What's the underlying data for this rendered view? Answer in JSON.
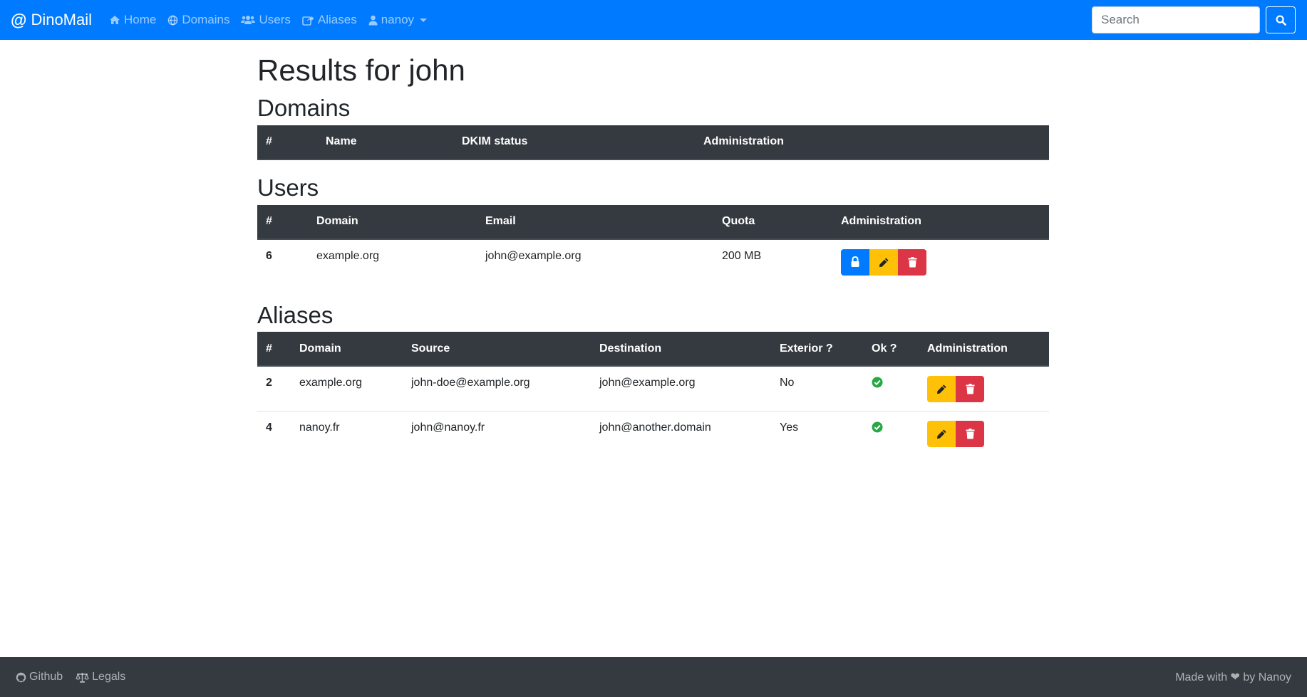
{
  "navbar": {
    "brand": "DinoMail",
    "items": [
      {
        "label": "Home",
        "icon": "home-icon"
      },
      {
        "label": "Domains",
        "icon": "globe-icon"
      },
      {
        "label": "Users",
        "icon": "users-icon"
      },
      {
        "label": "Aliases",
        "icon": "share-icon"
      }
    ],
    "user_menu": {
      "label": "nanoy",
      "icon": "user-icon"
    },
    "search": {
      "placeholder": "Search",
      "value": ""
    }
  },
  "page": {
    "title": "Results for john"
  },
  "domains_section": {
    "title": "Domains",
    "columns": [
      "#",
      "Name",
      "DKIM status",
      "Administration"
    ],
    "rows": []
  },
  "users_section": {
    "title": "Users",
    "columns": [
      "#",
      "Domain",
      "Email",
      "Quota",
      "Administration"
    ],
    "rows": [
      {
        "id": "6",
        "domain": "example.org",
        "email": "john@example.org",
        "quota": "200 MB"
      }
    ]
  },
  "aliases_section": {
    "title": "Aliases",
    "columns": [
      "#",
      "Domain",
      "Source",
      "Destination",
      "Exterior ?",
      "Ok ?",
      "Administration"
    ],
    "rows": [
      {
        "id": "2",
        "domain": "example.org",
        "source": "john-doe@example.org",
        "destination": "john@example.org",
        "exterior": "No",
        "ok": "check-circle-icon"
      },
      {
        "id": "4",
        "domain": "nanoy.fr",
        "source": "john@nanoy.fr",
        "destination": "john@another.domain",
        "exterior": "Yes",
        "ok": "check-circle-icon"
      }
    ]
  },
  "footer": {
    "links": [
      {
        "label": "Github",
        "icon": "github-icon"
      },
      {
        "label": "Legals",
        "icon": "balance-scale-icon"
      }
    ],
    "credit": "Made with ❤ by Nanoy"
  },
  "colors": {
    "primary": "#007bff",
    "dark": "#343a40",
    "warning": "#ffc107",
    "danger": "#dc3545",
    "success": "#28a745"
  }
}
